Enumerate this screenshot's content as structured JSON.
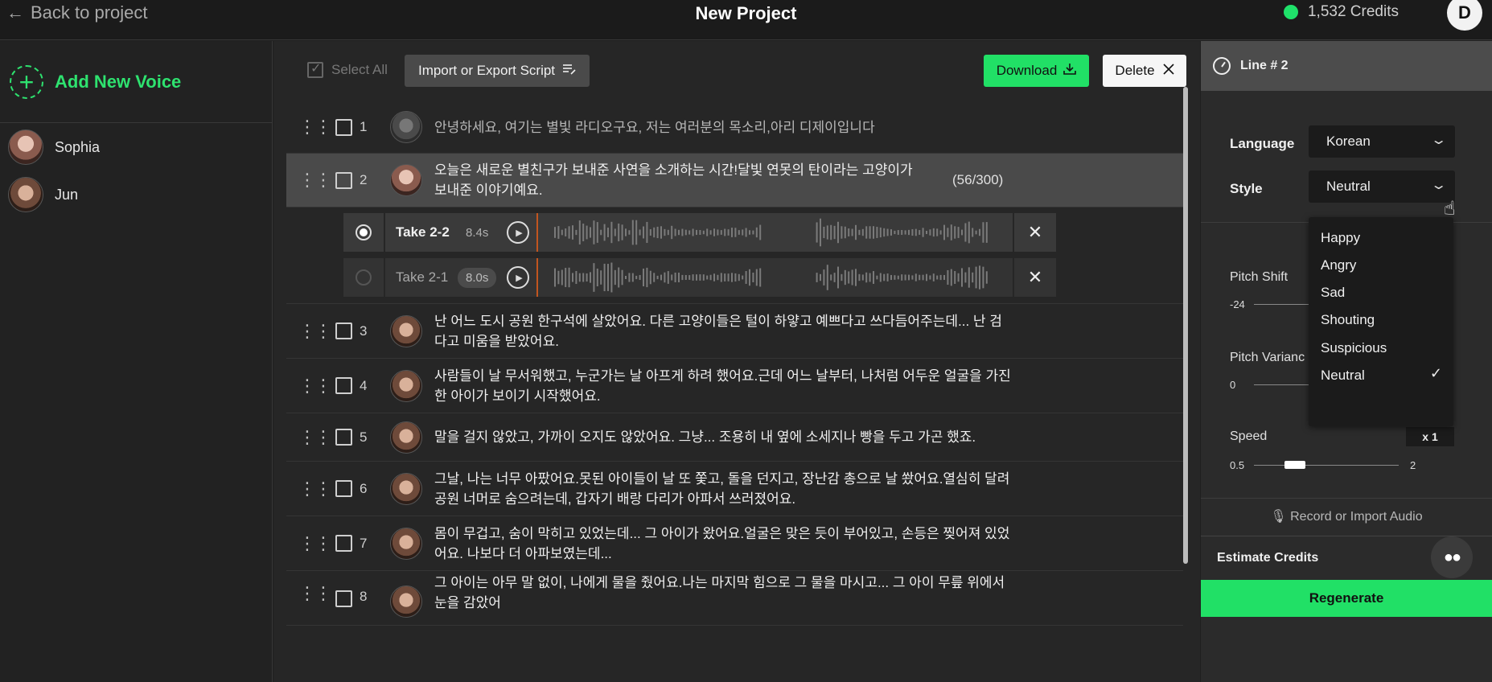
{
  "header": {
    "back_label": "Back to project",
    "title": "New Project",
    "credits": "1,532 Credits",
    "avatar_letter": "D"
  },
  "sidebar": {
    "add_voice_label": "Add New Voice",
    "voices": [
      {
        "name": "Sophia"
      },
      {
        "name": "Jun"
      }
    ]
  },
  "toolbar": {
    "select_all": "Select All",
    "import_export": "Import or Export Script",
    "download": "Download",
    "delete": "Delete"
  },
  "lines": [
    {
      "num": "1",
      "text": "안녕하세요, 여기는 별빛 라디오구요, 저는 여러분의 목소리,아리 디제이입니다"
    },
    {
      "num": "2",
      "text": "오늘은 새로운 별친구가 보내준 사연을 소개하는 시간!달빛 연못의 탄이라는 고양이가 보내준 이야기예요.",
      "count": "(56/300)"
    },
    {
      "num": "3",
      "text": "난 어느 도시 공원 한구석에 살았어요. 다른 고양이들은 털이 하얗고 예쁘다고 쓰다듬어주는데... 난 검다고 미움을 받았어요."
    },
    {
      "num": "4",
      "text": "사람들이 날 무서워했고, 누군가는 날 아프게 하려 했어요.근데 어느 날부터, 나처럼 어두운 얼굴을 가진 한 아이가 보이기 시작했어요."
    },
    {
      "num": "5",
      "text": "말을 걸지 않았고, 가까이 오지도 않았어요. 그냥... 조용히 내 옆에 소세지나 빵을 두고 가곤 했죠."
    },
    {
      "num": "6",
      "text": "그날, 나는 너무 아팠어요.못된 아이들이 날 또 쫓고, 돌을 던지고, 장난감 총으로 날 쐈어요.열심히 달려 공원 너머로 숨으려는데, 갑자기 배랑 다리가 아파서 쓰러졌어요."
    },
    {
      "num": "7",
      "text": "몸이 무겁고, 숨이 막히고 있었는데... 그 아이가 왔어요.얼굴은 맞은 듯이 부어있고, 손등은 찢어져 있었어요. 나보다 더 아파보였는데..."
    },
    {
      "num": "8",
      "text": "그 아이는 아무 말 없이, 나에게 물을 줬어요.나는 마지막 힘으로 그 물을 마시고... 그 아이 무릎 위에서 눈을 감았어"
    }
  ],
  "takes": [
    {
      "name": "Take 2-2",
      "duration": "8.4s"
    },
    {
      "name": "Take 2-1",
      "duration": "8.0s"
    }
  ],
  "panel": {
    "line_title": "Line # 2",
    "language_label": "Language",
    "language_value": "Korean",
    "style_label": "Style",
    "style_value": "Neutral",
    "pitch_shift_label": "Pitch Shift",
    "pitch_shift_min": "-24",
    "pitch_variance_label": "Pitch Varianc",
    "pitch_variance_min": "0",
    "speed_label": "Speed",
    "speed_value": "x 1",
    "speed_min": "0.5",
    "speed_max": "2",
    "record_label": "Record or Import Audio",
    "estimate_label": "Estimate Credits",
    "regenerate_label": "Regenerate"
  },
  "style_menu": {
    "options": [
      "Happy",
      "Angry",
      "Sad",
      "Shouting",
      "Suspicious",
      "Neutral"
    ],
    "selected": "Neutral"
  },
  "colors": {
    "accent": "#21e066",
    "take_marker": "#c2551f"
  }
}
